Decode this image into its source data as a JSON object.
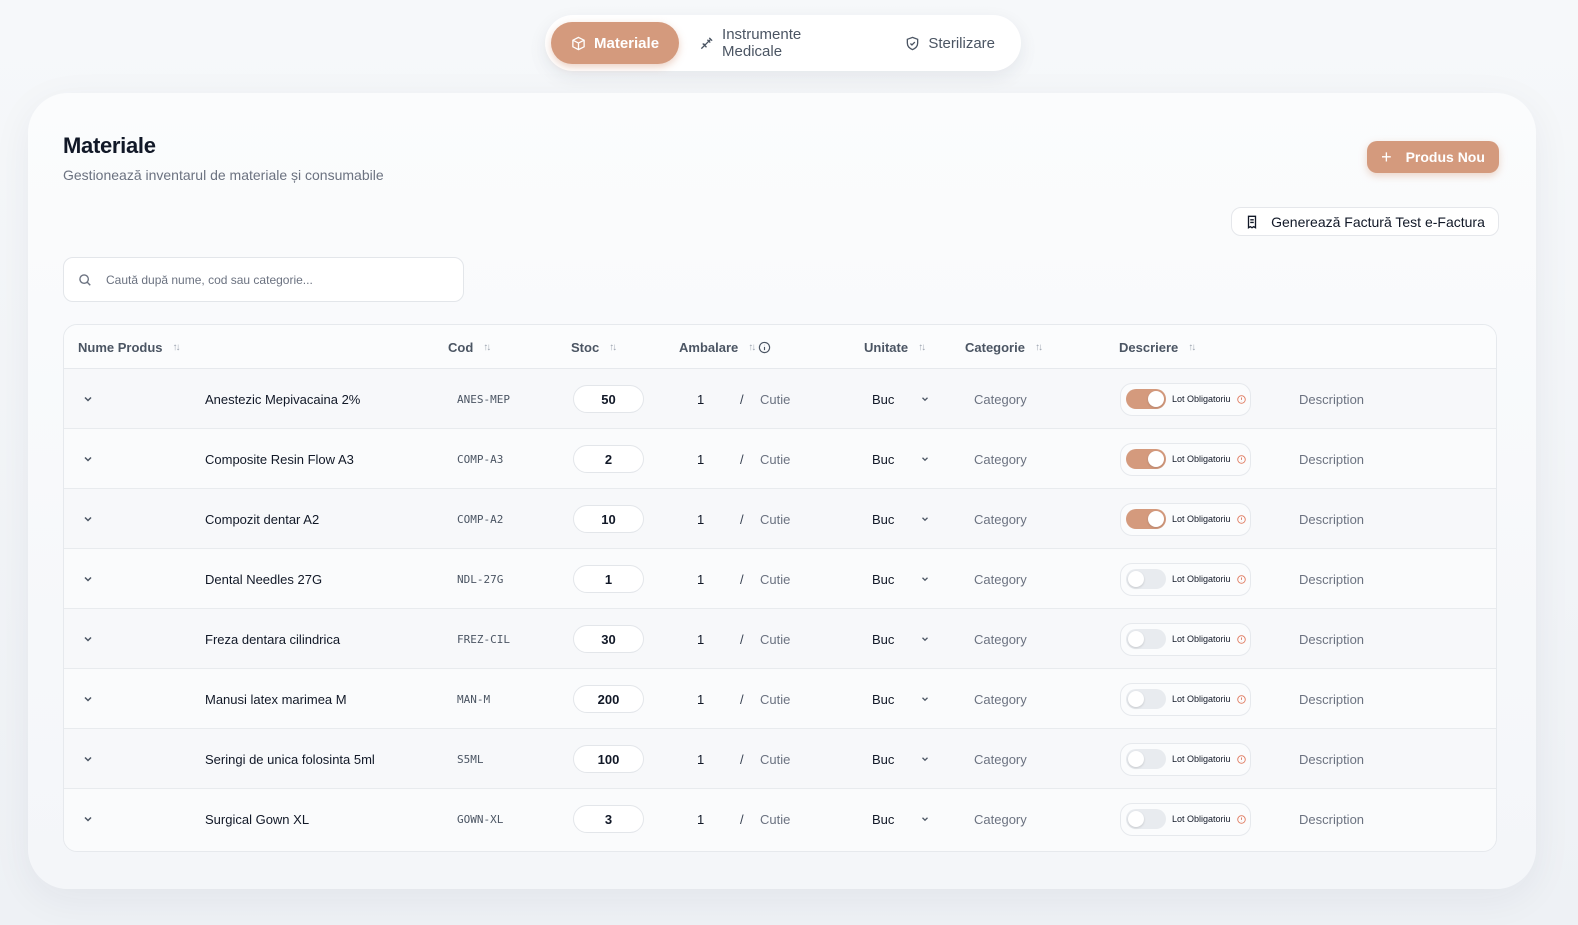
{
  "tabs": [
    {
      "label": "Materiale",
      "icon": "box-icon",
      "active": true
    },
    {
      "label": "Instrumente Medicale",
      "icon": "syringe-icon",
      "active": false
    },
    {
      "label": "Sterilizare",
      "icon": "shield-icon",
      "active": false
    }
  ],
  "header": {
    "title": "Materiale",
    "subtitle": "Gestionează inventarul de materiale și consumabile",
    "new_button": "Produs Nou",
    "invoice_button": "Generează Factură Test e-Factura"
  },
  "search": {
    "placeholder": "Caută după nume, cod sau categorie..."
  },
  "table": {
    "columns": {
      "name": "Nume Produs",
      "code": "Cod",
      "stock": "Stoc",
      "packaging": "Ambalare",
      "unit": "Unitate",
      "category": "Categorie",
      "description": "Descriere"
    },
    "rows": [
      {
        "name": "Anestezic Mepivacaina 2%",
        "code": "ANES-MEP",
        "stock": "50",
        "pack_qty": "1",
        "pack_unit": "Cutie",
        "unit": "Buc",
        "category": "Category",
        "lot_label": "Lot Obligatoriu",
        "lot_on": true,
        "description": "Description"
      },
      {
        "name": "Composite Resin Flow A3",
        "code": "COMP-A3",
        "stock": "2",
        "pack_qty": "1",
        "pack_unit": "Cutie",
        "unit": "Buc",
        "category": "Category",
        "lot_label": "Lot Obligatoriu",
        "lot_on": true,
        "description": "Description"
      },
      {
        "name": "Compozit dentar A2",
        "code": "COMP-A2",
        "stock": "10",
        "pack_qty": "1",
        "pack_unit": "Cutie",
        "unit": "Buc",
        "category": "Category",
        "lot_label": "Lot Obligatoriu",
        "lot_on": true,
        "description": "Description"
      },
      {
        "name": "Dental Needles 27G",
        "code": "NDL-27G",
        "stock": "1",
        "pack_qty": "1",
        "pack_unit": "Cutie",
        "unit": "Buc",
        "category": "Category",
        "lot_label": "Lot Obligatoriu",
        "lot_on": false,
        "description": "Description"
      },
      {
        "name": "Freza dentara cilindrica",
        "code": "FREZ-CIL",
        "stock": "30",
        "pack_qty": "1",
        "pack_unit": "Cutie",
        "unit": "Buc",
        "category": "Category",
        "lot_label": "Lot Obligatoriu",
        "lot_on": false,
        "description": "Description"
      },
      {
        "name": "Manusi latex marimea M",
        "code": "MAN-M",
        "stock": "200",
        "pack_qty": "1",
        "pack_unit": "Cutie",
        "unit": "Buc",
        "category": "Category",
        "lot_label": "Lot Obligatoriu",
        "lot_on": false,
        "description": "Description"
      },
      {
        "name": "Seringi de unica folosinta 5ml",
        "code": "S5ML",
        "stock": "100",
        "pack_qty": "1",
        "pack_unit": "Cutie",
        "unit": "Buc",
        "category": "Category",
        "lot_label": "Lot Obligatoriu",
        "lot_on": false,
        "description": "Description"
      },
      {
        "name": "Surgical Gown XL",
        "code": "GOWN-XL",
        "stock": "3",
        "pack_qty": "1",
        "pack_unit": "Cutie",
        "unit": "Buc",
        "category": "Category",
        "lot_label": "Lot Obligatoriu",
        "lot_on": false,
        "description": "Description"
      }
    ]
  },
  "colors": {
    "accent": "#d49a7d",
    "toggle_off": "#e8ebef",
    "warn": "#e07a5f"
  }
}
